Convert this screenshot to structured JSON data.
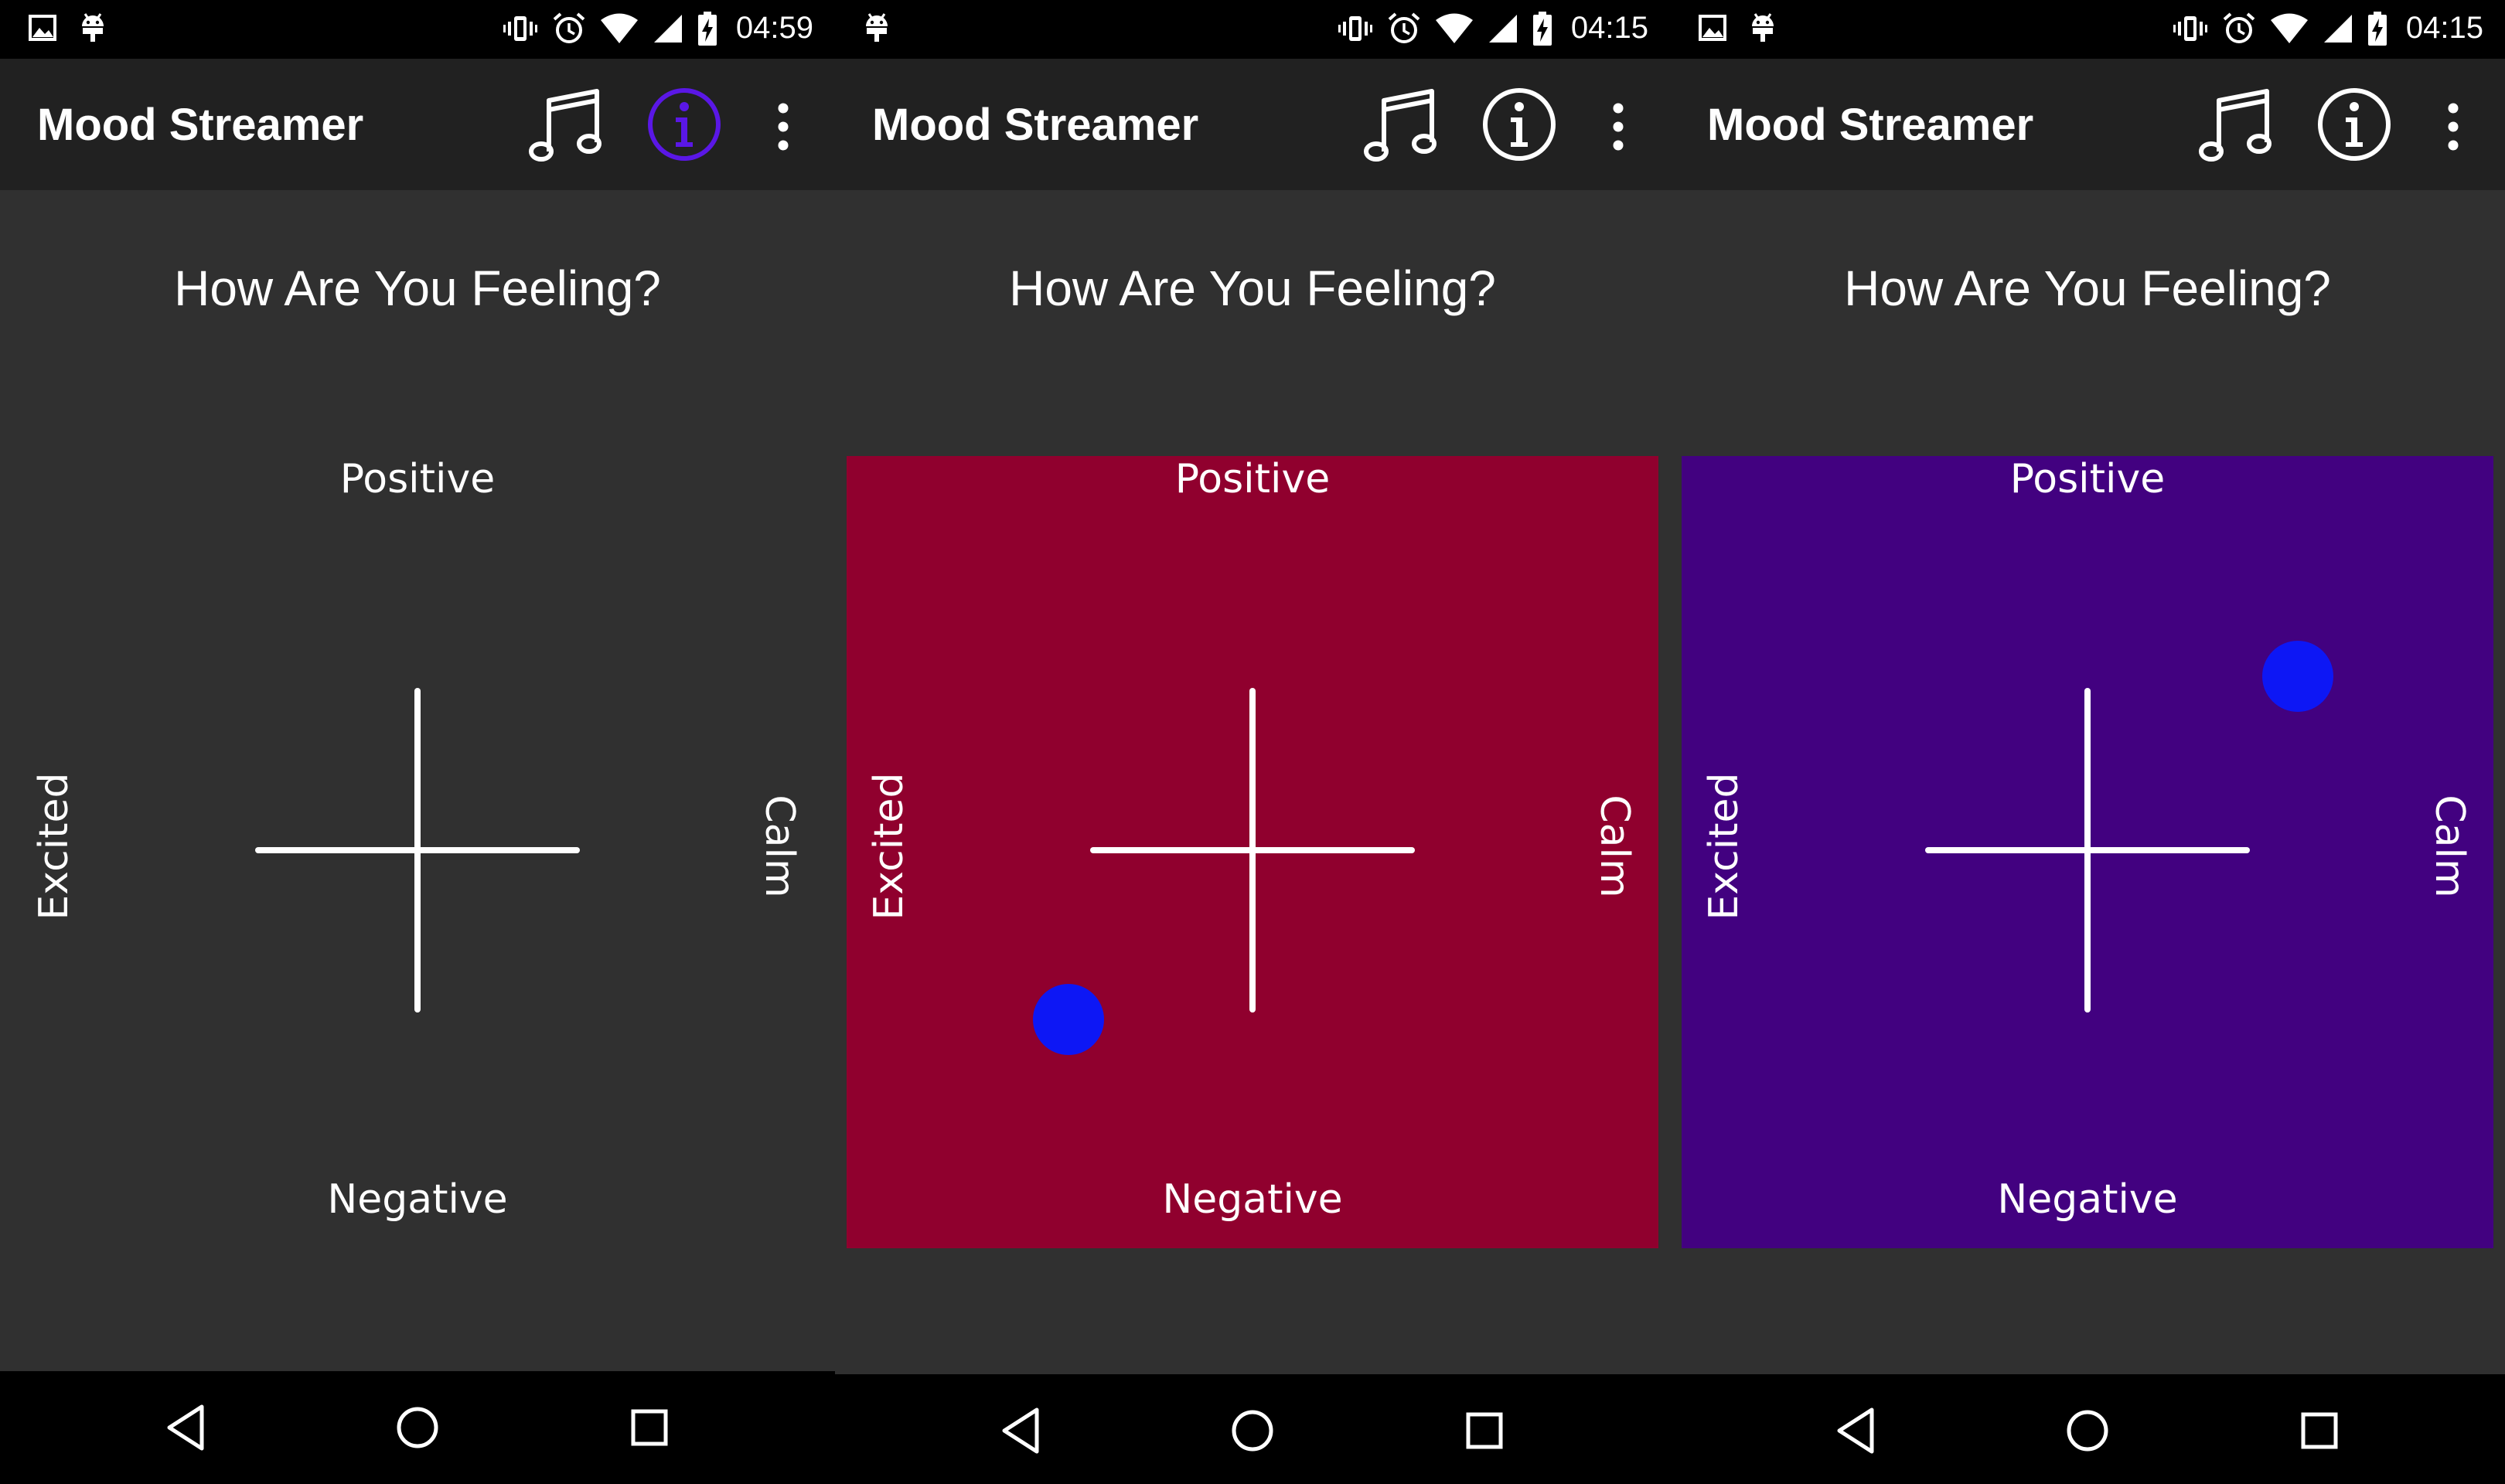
{
  "panels": [
    {
      "status": {
        "time": "04:59",
        "left_icons": [
          "image-icon",
          "android-icon"
        ],
        "right_icons": [
          "vibrate-icon",
          "alarm-icon",
          "wifi-icon",
          "signal-icon",
          "battery-charging-icon"
        ]
      },
      "app_title": "Mood Streamer",
      "question": "How Are You Feeling?",
      "pad": {
        "top_label": "Positive",
        "bottom_label": "Negative",
        "left_label": "Excited",
        "right_label": "Calm",
        "color": "#303030",
        "selected": false
      },
      "info_icon_active": true
    },
    {
      "status": {
        "time": "04:15",
        "left_icons": [
          "android-icon"
        ],
        "right_icons": [
          "vibrate-icon",
          "alarm-icon",
          "wifi-icon",
          "signal-icon",
          "battery-charging-icon"
        ]
      },
      "app_title": "Mood Streamer",
      "question": "How Are You Feeling?",
      "pad": {
        "top_label": "Positive",
        "bottom_label": "Negative",
        "left_label": "Excited",
        "right_label": "Calm",
        "color": "#90002e",
        "selected": true
      },
      "info_icon_active": false
    },
    {
      "status": {
        "time": "04:15",
        "left_icons": [
          "image-icon",
          "android-icon"
        ],
        "right_icons": [
          "vibrate-icon",
          "alarm-icon",
          "wifi-icon",
          "signal-icon",
          "battery-charging-icon"
        ]
      },
      "app_title": "Mood Streamer",
      "question": "How Are You Feeling?",
      "pad": {
        "top_label": "Positive",
        "bottom_label": "Negative",
        "left_label": "Excited",
        "right_label": "Calm",
        "color": "#420180",
        "selected": true
      },
      "info_icon_active": false
    }
  ],
  "colors": {
    "dot": "#0d17f5",
    "info_active": "#5a17e6",
    "appbar": "#212121",
    "background": "#303030"
  },
  "nav_icons": [
    "back-icon",
    "home-icon",
    "recents-icon"
  ]
}
